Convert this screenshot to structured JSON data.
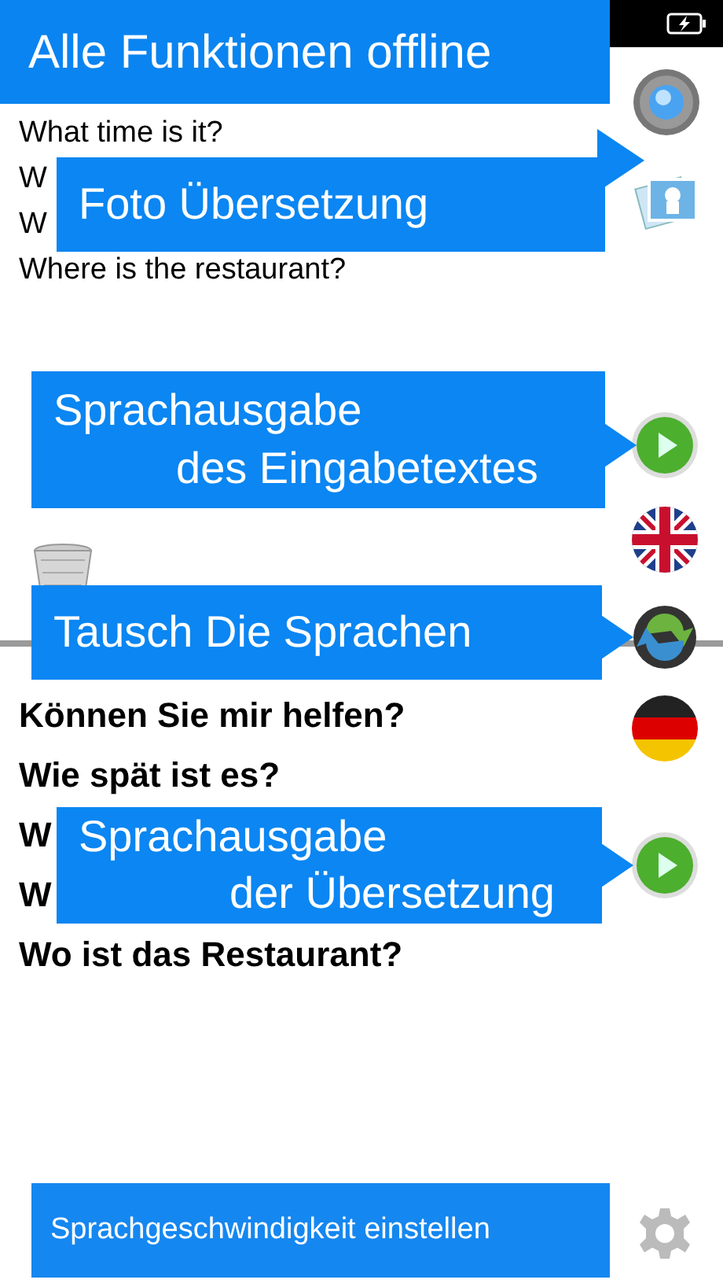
{
  "source_phrases": [
    {
      "text": "What time is it?"
    },
    {
      "text": "W"
    },
    {
      "text": "W"
    },
    {
      "text": "Where is the restaurant?"
    }
  ],
  "translated_phrases": [
    {
      "text": "Können Sie mir helfen?"
    },
    {
      "text": "Wie spät ist es?"
    },
    {
      "text": "W"
    },
    {
      "text": "W"
    },
    {
      "text": "Wo ist das Restaurant?"
    }
  ],
  "callouts": [
    {
      "lines": [
        "Alle Funktionen offline"
      ],
      "kind": "banner"
    },
    {
      "lines": [
        "Foto Übersetzung"
      ],
      "kind": "pointer"
    },
    {
      "lines": [
        "Sprachausgabe",
        "des Eingabetextes"
      ],
      "kind": "pointer"
    },
    {
      "lines": [
        "Tausch Die Sprachen"
      ],
      "kind": "pointer"
    },
    {
      "lines": [
        "Sprachausgabe",
        "der Übersetzung"
      ],
      "kind": "pointer"
    },
    {
      "lines": [
        "Sprachgeschwindigkeit einstellen"
      ],
      "kind": "small"
    }
  ]
}
